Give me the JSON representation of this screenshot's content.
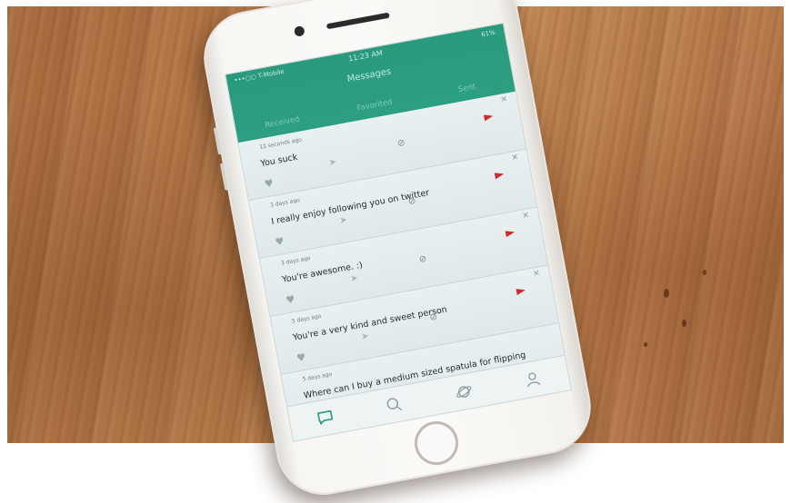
{
  "status": {
    "carrier": "•••○○ T-Mobile",
    "time": "11:23 AM",
    "battery": "61%"
  },
  "header": {
    "title": "Messages"
  },
  "tabs": [
    {
      "label": "Received",
      "active": true
    },
    {
      "label": "Favorited",
      "active": false
    },
    {
      "label": "Sent",
      "active": false
    }
  ],
  "messages": [
    {
      "time": "12 seconds ago",
      "text": "You suck"
    },
    {
      "time": "3 days ago",
      "text": "I really enjoy following you on twitter"
    },
    {
      "time": "3 days ago",
      "text": "You're awesome. :)"
    },
    {
      "time": "5 days ago",
      "text": "You're a very kind and sweet person"
    },
    {
      "time": "5 days ago",
      "text": "Where can I buy a medium sized spatula for flipping"
    }
  ],
  "nav": [
    "chat-bubble-icon",
    "search-icon",
    "planet-icon",
    "profile-icon"
  ],
  "colors": {
    "accent": "#2a9a7c",
    "flag": "#d0282e",
    "active_nav": "#2a9a7c"
  }
}
